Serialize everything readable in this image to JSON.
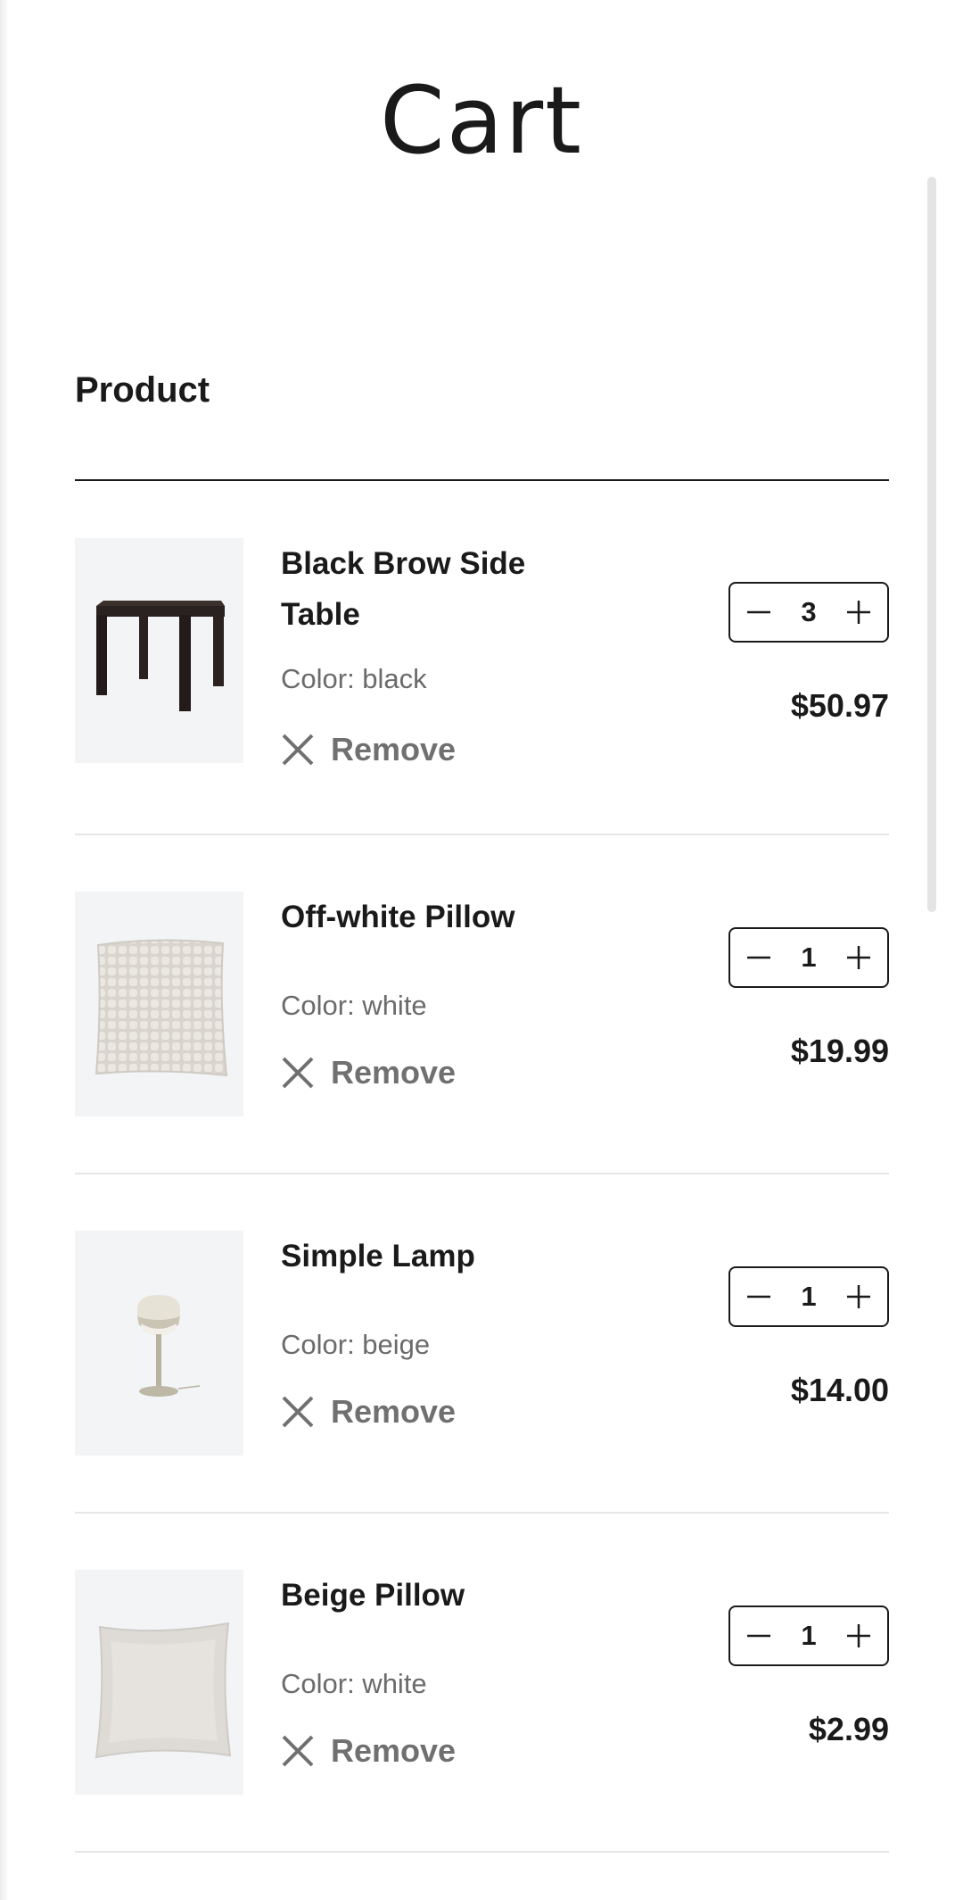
{
  "page": {
    "title": "Cart",
    "column_header": "Product"
  },
  "items": [
    {
      "name": "Black Brow Side Table",
      "color": "Color: black",
      "remove_label": "Remove",
      "quantity": "3",
      "price": "$50.97",
      "image_icon": "side-table-icon"
    },
    {
      "name": "Off-white Pillow",
      "color": "Color: white",
      "remove_label": "Remove",
      "quantity": "1",
      "price": "$19.99",
      "image_icon": "textured-pillow-icon"
    },
    {
      "name": "Simple Lamp",
      "color": "Color: beige",
      "remove_label": "Remove",
      "quantity": "1",
      "price": "$14.00",
      "image_icon": "table-lamp-icon"
    },
    {
      "name": "Beige Pillow",
      "color": "Color: white",
      "remove_label": "Remove",
      "quantity": "1",
      "price": "$2.99",
      "image_icon": "plain-pillow-icon"
    }
  ],
  "colors": {
    "text": "#1a1a1a",
    "muted": "#6b6b6b",
    "image_bg": "#f2f4f6",
    "divider": "#e6e6e6"
  }
}
